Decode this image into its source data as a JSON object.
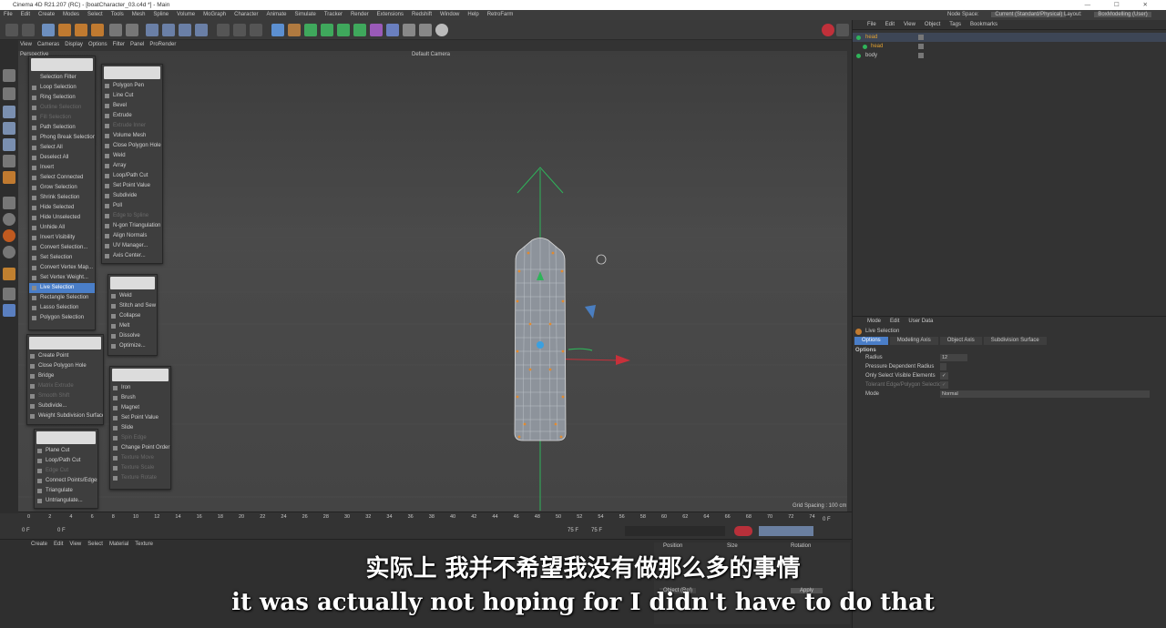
{
  "window": {
    "title": "Cinema 4D R21.207 (RC) - [boatCharacter_03.c4d *] - Main"
  },
  "menubar": [
    "File",
    "Edit",
    "Create",
    "Modes",
    "Select",
    "Tools",
    "Mesh",
    "Spline",
    "Volume",
    "MoGraph",
    "Character",
    "Animate",
    "Simulate",
    "Tracker",
    "Render",
    "Extensions",
    "Redshift",
    "Window",
    "Help",
    "RetroFarm"
  ],
  "node_space": {
    "label": "Node Space:",
    "value": "Current (Standard/Physical)"
  },
  "layout": {
    "label": "Layout:",
    "value": "BoxModelling (User)"
  },
  "viewmenu": [
    "View",
    "Cameras",
    "Display",
    "Options",
    "Filter",
    "Panel",
    "ProRender"
  ],
  "viewport": {
    "name": "Perspective",
    "camera": "Default Camera",
    "grid_spacing": "Grid Spacing : 100 cm"
  },
  "panels": {
    "select": {
      "label": "Selection Filter",
      "items": [
        {
          "label": "Loop Selection",
          "state": "normal"
        },
        {
          "label": "Ring Selection",
          "state": "normal"
        },
        {
          "label": "Outline Selection",
          "state": "disabled"
        },
        {
          "label": "Fill Selection",
          "state": "disabled"
        },
        {
          "label": "Path Selection",
          "state": "normal"
        },
        {
          "label": "Phong Break Selection",
          "state": "normal"
        },
        {
          "label": "Select All",
          "state": "normal"
        },
        {
          "label": "Deselect All",
          "state": "normal"
        },
        {
          "label": "Invert",
          "state": "normal"
        },
        {
          "label": "Select Connected",
          "state": "normal"
        },
        {
          "label": "Grow Selection",
          "state": "normal"
        },
        {
          "label": "Shrink Selection",
          "state": "normal"
        },
        {
          "label": "Hide Selected",
          "state": "normal"
        },
        {
          "label": "Hide Unselected",
          "state": "normal"
        },
        {
          "label": "Unhide All",
          "state": "normal"
        },
        {
          "label": "Invert Visibility",
          "state": "normal"
        },
        {
          "label": "Convert Selection...",
          "state": "normal"
        },
        {
          "label": "Set Selection",
          "state": "normal"
        },
        {
          "label": "Convert Vertex Map...",
          "state": "normal"
        },
        {
          "label": "Set Vertex Weight...",
          "state": "normal"
        },
        {
          "label": "Live Selection",
          "state": "selected"
        },
        {
          "label": "Rectangle Selection",
          "state": "normal"
        },
        {
          "label": "Lasso Selection",
          "state": "normal"
        },
        {
          "label": "Polygon Selection",
          "state": "normal"
        }
      ]
    },
    "mesh": {
      "items": [
        {
          "label": "Polygon Pen",
          "state": "normal"
        },
        {
          "label": "Line Cut",
          "state": "normal"
        },
        {
          "label": "Bevel",
          "state": "normal"
        },
        {
          "label": "Extrude",
          "state": "normal"
        },
        {
          "label": "Extrude Inner",
          "state": "disabled"
        },
        {
          "label": "Volume Mesh",
          "state": "normal"
        },
        {
          "label": "Close Polygon Hole",
          "state": "normal"
        },
        {
          "label": "Weld",
          "state": "normal"
        },
        {
          "label": "Array",
          "state": "normal"
        },
        {
          "label": "Loop/Path Cut",
          "state": "normal"
        },
        {
          "label": "Set Point Value",
          "state": "normal"
        },
        {
          "label": "Subdivide",
          "state": "normal"
        },
        {
          "label": "Poll",
          "state": "normal"
        },
        {
          "label": "Edge to Spline",
          "state": "disabled"
        },
        {
          "label": "N-gon Triangulation",
          "state": "normal"
        },
        {
          "label": "Align Normals",
          "state": "normal"
        },
        {
          "label": "UV Manager...",
          "state": "normal"
        },
        {
          "label": "Axis Center...",
          "state": "normal"
        }
      ]
    },
    "points": {
      "items": [
        {
          "label": "Create Point",
          "state": "normal"
        },
        {
          "label": "Close Polygon Hole",
          "state": "normal"
        },
        {
          "label": "Bridge",
          "state": "normal"
        },
        {
          "label": "Matrix Extrude",
          "state": "disabled"
        },
        {
          "label": "Smooth Shift",
          "state": "disabled"
        },
        {
          "label": "Subdivide...",
          "state": "normal"
        },
        {
          "label": "Weight Subdivision Surface",
          "state": "normal"
        }
      ]
    },
    "weld": {
      "items": [
        {
          "label": "Weld",
          "state": "normal"
        },
        {
          "label": "Stitch and Sew",
          "state": "normal"
        },
        {
          "label": "Collapse",
          "state": "normal"
        },
        {
          "label": "Melt",
          "state": "normal"
        },
        {
          "label": "Dissolve",
          "state": "normal"
        },
        {
          "label": "Optimize...",
          "state": "normal"
        }
      ]
    },
    "iron": {
      "items": [
        {
          "label": "Iron",
          "state": "normal"
        },
        {
          "label": "Brush",
          "state": "normal"
        },
        {
          "label": "Magnet",
          "state": "normal"
        },
        {
          "label": "Set Point Value",
          "state": "normal"
        },
        {
          "label": "Slide",
          "state": "normal"
        },
        {
          "label": "Spin Edge",
          "state": "disabled"
        },
        {
          "label": "Change Point Order",
          "state": "normal"
        },
        {
          "label": "Texture Move",
          "state": "disabled"
        },
        {
          "label": "Texture Scale",
          "state": "disabled"
        },
        {
          "label": "Texture Rotate",
          "state": "disabled"
        }
      ]
    },
    "cut": {
      "items": [
        {
          "label": "Plane Cut",
          "state": "normal"
        },
        {
          "label": "Loop/Path Cut",
          "state": "normal"
        },
        {
          "label": "Edge Cut",
          "state": "disabled"
        },
        {
          "label": "Connect Points/Edges",
          "state": "normal"
        },
        {
          "label": "Triangulate",
          "state": "normal"
        },
        {
          "label": "Untriangulate...",
          "state": "normal"
        }
      ]
    }
  },
  "objmgr": {
    "menu": [
      "File",
      "Edit",
      "View",
      "Object",
      "Tags",
      "Bookmarks"
    ],
    "objects": [
      {
        "label": "head",
        "color": "#e0a030"
      },
      {
        "label": "head",
        "color": "#e0a030"
      },
      {
        "label": "body",
        "color": "#c8c8c8"
      }
    ]
  },
  "attr": {
    "menu": [
      "Mode",
      "Edit",
      "User Data"
    ],
    "tool": "Live Selection",
    "tabs": [
      "Options",
      "Modeling Axis",
      "Object Axis",
      "Subdivision Surface"
    ],
    "section": "Options",
    "fields": [
      {
        "label": "Radius",
        "value": "12"
      },
      {
        "label": "Pressure Dependent Radius",
        "value": ""
      },
      {
        "label": "Only Select Visible Elements",
        "value": "✓"
      },
      {
        "label": "Tolerant Edge/Polygon Selection",
        "value": "✓"
      },
      {
        "label": "Mode",
        "value": "Normal"
      }
    ]
  },
  "timeline": {
    "ticks": [
      "0",
      "2",
      "4",
      "6",
      "8",
      "10",
      "12",
      "14",
      "16",
      "18",
      "20",
      "22",
      "24",
      "26",
      "28",
      "30",
      "32",
      "34",
      "36",
      "38",
      "40",
      "42",
      "44",
      "46",
      "48",
      "50",
      "52",
      "54",
      "56",
      "58",
      "60",
      "62",
      "64",
      "66",
      "68",
      "70",
      "72",
      "74"
    ],
    "start": "0 F",
    "current": "0 F",
    "end": "75 F",
    "end2": "75 F",
    "frame": "0 F"
  },
  "materials": {
    "menu": [
      "Create",
      "Edit",
      "View",
      "Select",
      "Material",
      "Texture"
    ]
  },
  "coords": {
    "headers": [
      "Position",
      "Size",
      "Rotation"
    ],
    "mode": "Object (Rel)",
    "apply": "Apply"
  },
  "subtitles": {
    "zh": "实际上 我并不希望我没有做那么多的事情",
    "en": "it was actually not hoping for I didn't have to do that"
  }
}
